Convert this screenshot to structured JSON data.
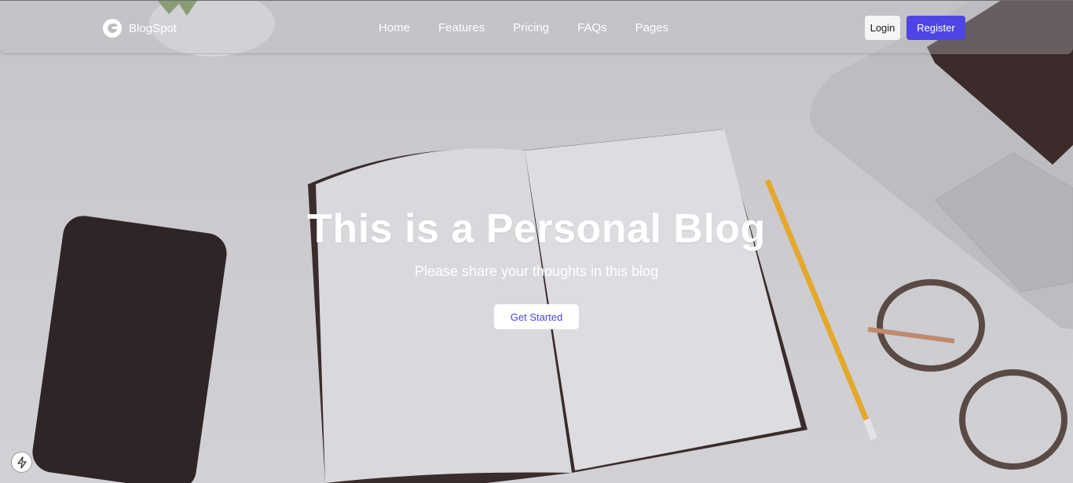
{
  "brand": {
    "name": "BlogSpot",
    "icon": "blogspot-logo-icon"
  },
  "nav": {
    "links": [
      "Home",
      "Features",
      "Pricing",
      "FAQs",
      "Pages"
    ]
  },
  "auth": {
    "login_label": "Login",
    "register_label": "Register"
  },
  "hero": {
    "title": "This is a Personal Blog",
    "subtitle": "Please share your thoughts in this blog",
    "cta_label": "Get Started"
  },
  "colors": {
    "accent": "#4f45e4",
    "text_on_hero": "#ffffff"
  },
  "widgets": {
    "corner_badge_icon": "lightning-bolt-icon"
  }
}
